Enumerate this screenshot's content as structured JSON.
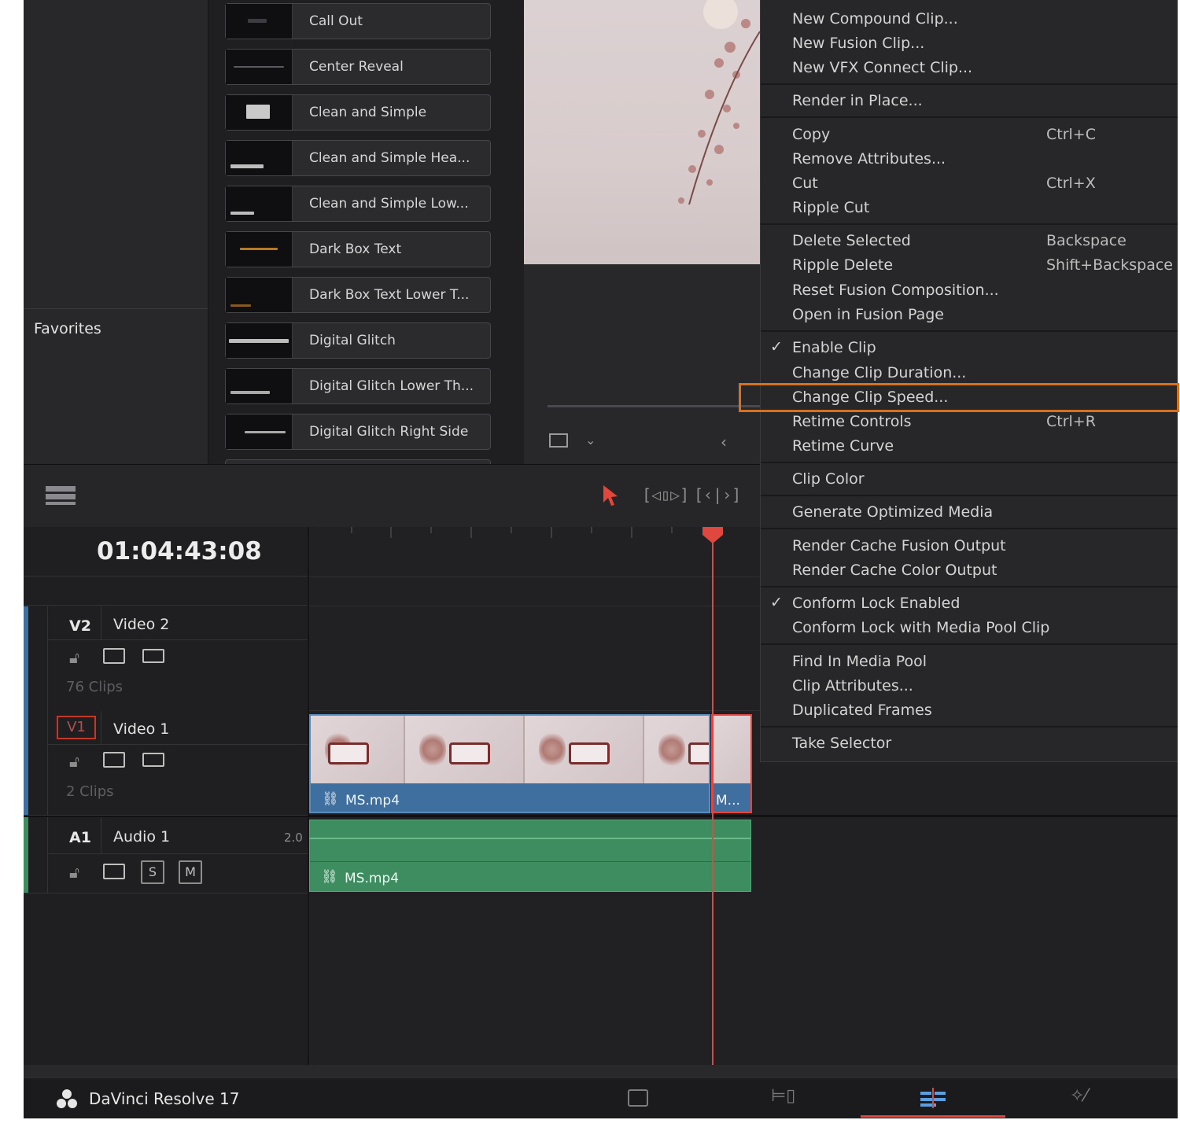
{
  "effects": {
    "favorites_label": "Favorites",
    "items": [
      {
        "name": "Call Out"
      },
      {
        "name": "Center Reveal"
      },
      {
        "name": "Clean and Simple"
      },
      {
        "name": "Clean and Simple Hea..."
      },
      {
        "name": "Clean and Simple Low..."
      },
      {
        "name": "Dark Box Text"
      },
      {
        "name": "Dark Box Text Lower T..."
      },
      {
        "name": "Digital Glitch"
      },
      {
        "name": "Digital Glitch Lower Th..."
      },
      {
        "name": "Digital Glitch Right Side"
      }
    ]
  },
  "timeline": {
    "timecode": "01:04:43:08",
    "tracks": {
      "v2": {
        "id": "V2",
        "name": "Video 2",
        "clips": "76 Clips"
      },
      "v1": {
        "id": "V1",
        "name": "Video 1",
        "clips": "2 Clips"
      },
      "a1": {
        "id": "A1",
        "name": "Audio 1",
        "channels": "2.0",
        "solo": "S",
        "mute": "M"
      }
    },
    "video_clip_label": "MS.mp4",
    "video_clip2_label": "M...",
    "audio_clip_label": "MS.mp4"
  },
  "context_menu": {
    "new_compound": "New Compound Clip...",
    "new_fusion": "New Fusion Clip...",
    "new_vfx": "New VFX Connect Clip...",
    "render_in_place": "Render in Place...",
    "copy": "Copy",
    "copy_sc": "Ctrl+C",
    "remove_attr": "Remove Attributes...",
    "cut": "Cut",
    "cut_sc": "Ctrl+X",
    "ripple_cut": "Ripple Cut",
    "delete_selected": "Delete Selected",
    "delete_selected_sc": "Backspace",
    "ripple_delete": "Ripple Delete",
    "ripple_delete_sc": "Shift+Backspace",
    "reset_fusion": "Reset Fusion Composition...",
    "open_fusion": "Open in Fusion Page",
    "enable_clip": "Enable Clip",
    "change_duration": "Change Clip Duration...",
    "change_speed": "Change Clip Speed...",
    "retime_controls": "Retime Controls",
    "retime_controls_sc": "Ctrl+R",
    "retime_curve": "Retime Curve",
    "clip_color": "Clip Color",
    "gen_optimized": "Generate Optimized Media",
    "render_cache_fusion": "Render Cache Fusion Output",
    "render_cache_color": "Render Cache Color Output",
    "conform_lock": "Conform Lock Enabled",
    "conform_lock_pool": "Conform Lock with Media Pool Clip",
    "find_pool": "Find In Media Pool",
    "clip_attributes": "Clip Attributes...",
    "duplicated_frames": "Duplicated Frames",
    "take_selector": "Take Selector",
    "highlighted": "Change Clip Speed..."
  },
  "footer": {
    "app_name": "DaVinci Resolve 17",
    "active_page": "edit"
  },
  "colors": {
    "accent_highlight": "#d8711e",
    "playhead": "#e0473f",
    "video_clip": "#3e6f9f",
    "audio_clip": "#3d8d61"
  }
}
